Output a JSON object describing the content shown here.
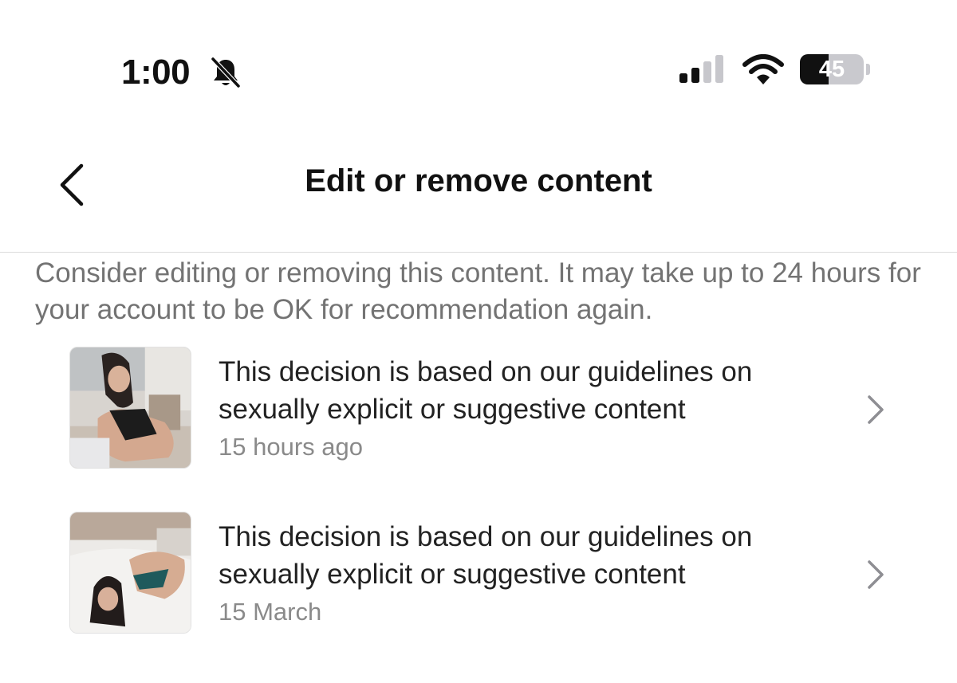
{
  "status_bar": {
    "time": "1:00",
    "battery_level": "45",
    "icons": [
      "bell-slash-icon",
      "cellular-signal-icon",
      "wifi-icon",
      "battery-icon"
    ]
  },
  "header": {
    "title": "Edit or remove content",
    "back_icon": "chevron-left-icon"
  },
  "intro": "Consider editing or removing this content. It may take up to 24 hours for your account to be OK for recommendation again.",
  "items": [
    {
      "thumbnail_icon": "post-thumbnail",
      "title": "This decision is based on our guidelines on sexually explicit or suggestive content",
      "time": "15 hours ago",
      "chevron_icon": "chevron-right-icon"
    },
    {
      "thumbnail_icon": "post-thumbnail",
      "title": "This decision is based on our guidelines on sexually explicit or suggestive content",
      "time": "15 March",
      "chevron_icon": "chevron-right-icon"
    }
  ],
  "colors": {
    "text_primary": "#111111",
    "text_secondary": "#737373",
    "timestamp": "#8a8a8a",
    "chevron": "#8e8e93",
    "divider": "#dcdcdc"
  }
}
